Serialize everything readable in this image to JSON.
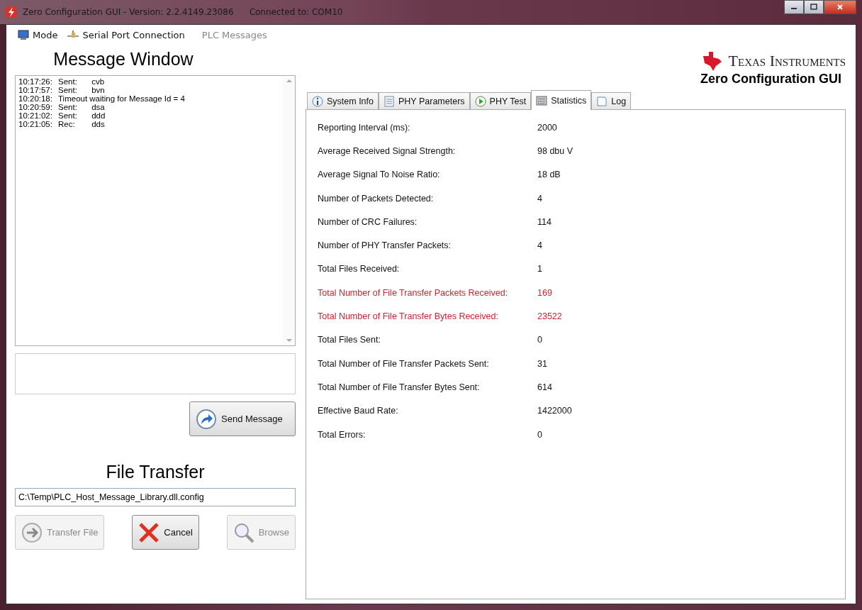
{
  "window": {
    "title": "Zero Configuration GUI - Version: 2.2.4149.23086",
    "connection": "Connected to: COM10"
  },
  "menu": [
    {
      "label": "Mode",
      "disabled": false
    },
    {
      "label": "Serial Port Connection",
      "disabled": false
    },
    {
      "label": "PLC Messages",
      "disabled": true
    }
  ],
  "message_window": {
    "title": "Message Window",
    "log": [
      {
        "time": "10:17:26:",
        "label": "Sent:",
        "text": "cvb"
      },
      {
        "time": "10:17:57:",
        "label": "Sent:",
        "text": "bvn"
      },
      {
        "time": "10:20:18:",
        "text": "Timeout waiting for Message Id = 4"
      },
      {
        "time": "10:20:59:",
        "label": "Sent:",
        "text": "dsa"
      },
      {
        "time": "10:21:02:",
        "label": "Sent:",
        "text": "ddd"
      },
      {
        "time": "10:21:05:",
        "label": "Rec:",
        "text": "dds"
      }
    ],
    "send_button": {
      "label": "Send Message",
      "disabled": false
    }
  },
  "file_transfer": {
    "title": "File Transfer",
    "path": "C:\\Temp\\PLC_Host_Message_Library.dll.config",
    "buttons": [
      {
        "label": "Transfer File",
        "disabled": true
      },
      {
        "label": "Cancel",
        "disabled": false
      },
      {
        "label": "Browse",
        "disabled": true
      }
    ]
  },
  "logo": {
    "brand": "Texas Instruments",
    "subtitle": "Zero Configuration GUI"
  },
  "tabs": [
    {
      "label": "System Info",
      "selected": false
    },
    {
      "label": "PHY Parameters",
      "selected": false
    },
    {
      "label": "PHY Test",
      "selected": false
    },
    {
      "label": "Statistics",
      "selected": true
    },
    {
      "label": "Log",
      "selected": false
    }
  ],
  "statistics": [
    {
      "label": "Reporting Interval (ms):",
      "value": "2000",
      "highlight": false
    },
    {
      "label": "Average Received Signal Strength:",
      "value": "98 dbu V",
      "highlight": false
    },
    {
      "label": "Average Signal To Noise Ratio:",
      "value": "18 dB",
      "highlight": false
    },
    {
      "label": "Number of Packets Detected:",
      "value": "4",
      "highlight": false
    },
    {
      "label": "Number of CRC Failures:",
      "value": "114",
      "highlight": false
    },
    {
      "label": "Number of PHY Transfer Packets:",
      "value": "4",
      "highlight": false
    },
    {
      "label": "Total Files Received:",
      "value": "1",
      "highlight": false
    },
    {
      "label": "Total Number of File Transfer Packets Received:",
      "value": "169",
      "highlight": true
    },
    {
      "label": "Total Number of File Transfer Bytes Received:",
      "value": "23522",
      "highlight": true
    },
    {
      "label": "Total Files Sent:",
      "value": "0",
      "highlight": false
    },
    {
      "label": "Total Number of File Transfer Packets Sent:",
      "value": "31",
      "highlight": false
    },
    {
      "label": "Total Number of File Transfer Bytes Sent:",
      "value": "614",
      "highlight": false
    },
    {
      "label": "Effective Baud Rate:",
      "value": "1422000",
      "highlight": false
    },
    {
      "label": "Total Errors:",
      "value": "0",
      "highlight": false
    }
  ]
}
